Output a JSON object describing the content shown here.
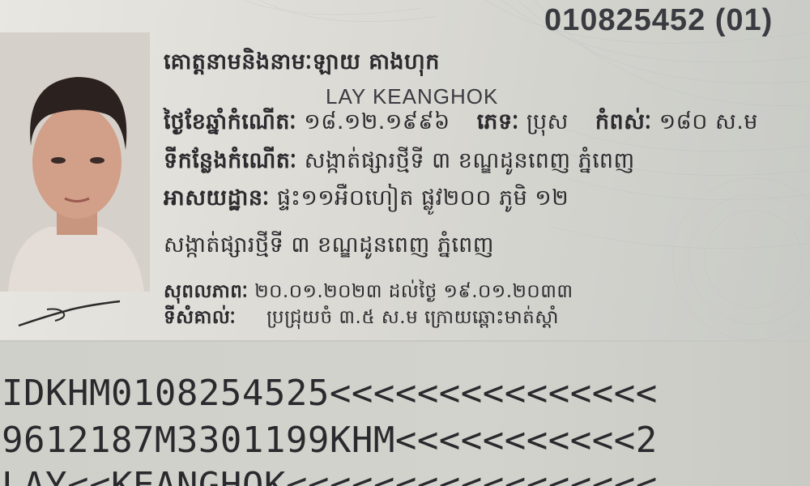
{
  "document_number": "010825452 (01)",
  "name_line": {
    "label": "គោត្តនាមនិងនាមៈ",
    "value": "ឡាយ គាងហុក"
  },
  "latin_name": "LAY KEANGHOK",
  "dob_line": {
    "dob_label": "ថ្ងៃខែឆ្នាំកំណើតៈ",
    "dob_value": "១៨.១២.១៩៩៦",
    "sex_label": "ភេទៈ",
    "sex_value": "ប្រុស",
    "height_label": "កំពស់ៈ",
    "height_value": "១៨០ ស.ម"
  },
  "pob_line": {
    "label": "ទីកន្លែងកំណើតៈ",
    "value": "សង្កាត់ផ្សារថ្មីទី ៣ ខណ្ឌដូនពេញ ភ្នំពេញ"
  },
  "address_line": {
    "label": "អាសយដ្ឋានៈ",
    "value": "ផ្ទះ១១អឺ០ហៀត ផ្លូវ២០០ ភូមិ ១២"
  },
  "address_line2": "សង្កាត់ផ្សារថ្មីទី ៣ ខណ្ឌដូនពេញ ភ្នំពេញ",
  "validity_line": {
    "label": "សុពលភាពៈ",
    "value": "២០.០១.២០២៣ ដល់ថ្ងៃ ១៩.០១.២០៣៣"
  },
  "marks_line": {
    "label": "ទីសំគាល់ៈ",
    "value": "ប្រជ្រុយចំ ៣.៥ ស.ម ក្រោយឆ្ពោះមាត់ស្តាំ"
  },
  "mrz": [
    "IDKHM0108254525<<<<<<<<<<<<<<<",
    "9612187M3301199KHM<<<<<<<<<<<2",
    "LAY<<KEANGHOK<<<<<<<<<<<<<<<<<"
  ],
  "colors": {
    "ink": "#2c2a2e",
    "card": "#dedcd6"
  }
}
